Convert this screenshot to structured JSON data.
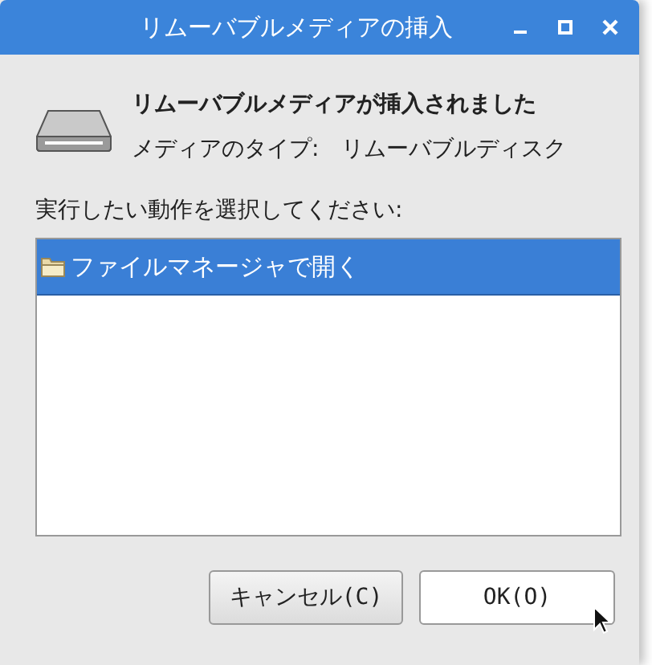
{
  "window": {
    "title": "リムーバブルメディアの挿入"
  },
  "heading": "リムーバブルメディアが挿入されました",
  "media_type": "メディアのタイプ:　リムーバブルディスク",
  "prompt": "実行したい動作を選択してください:",
  "actions": [
    {
      "label": "ファイルマネージャで開く",
      "selected": true
    }
  ],
  "buttons": [
    {
      "label": "キャンセル(C)",
      "kind": "cancel"
    },
    {
      "label": "OK(O)",
      "kind": "default"
    }
  ]
}
